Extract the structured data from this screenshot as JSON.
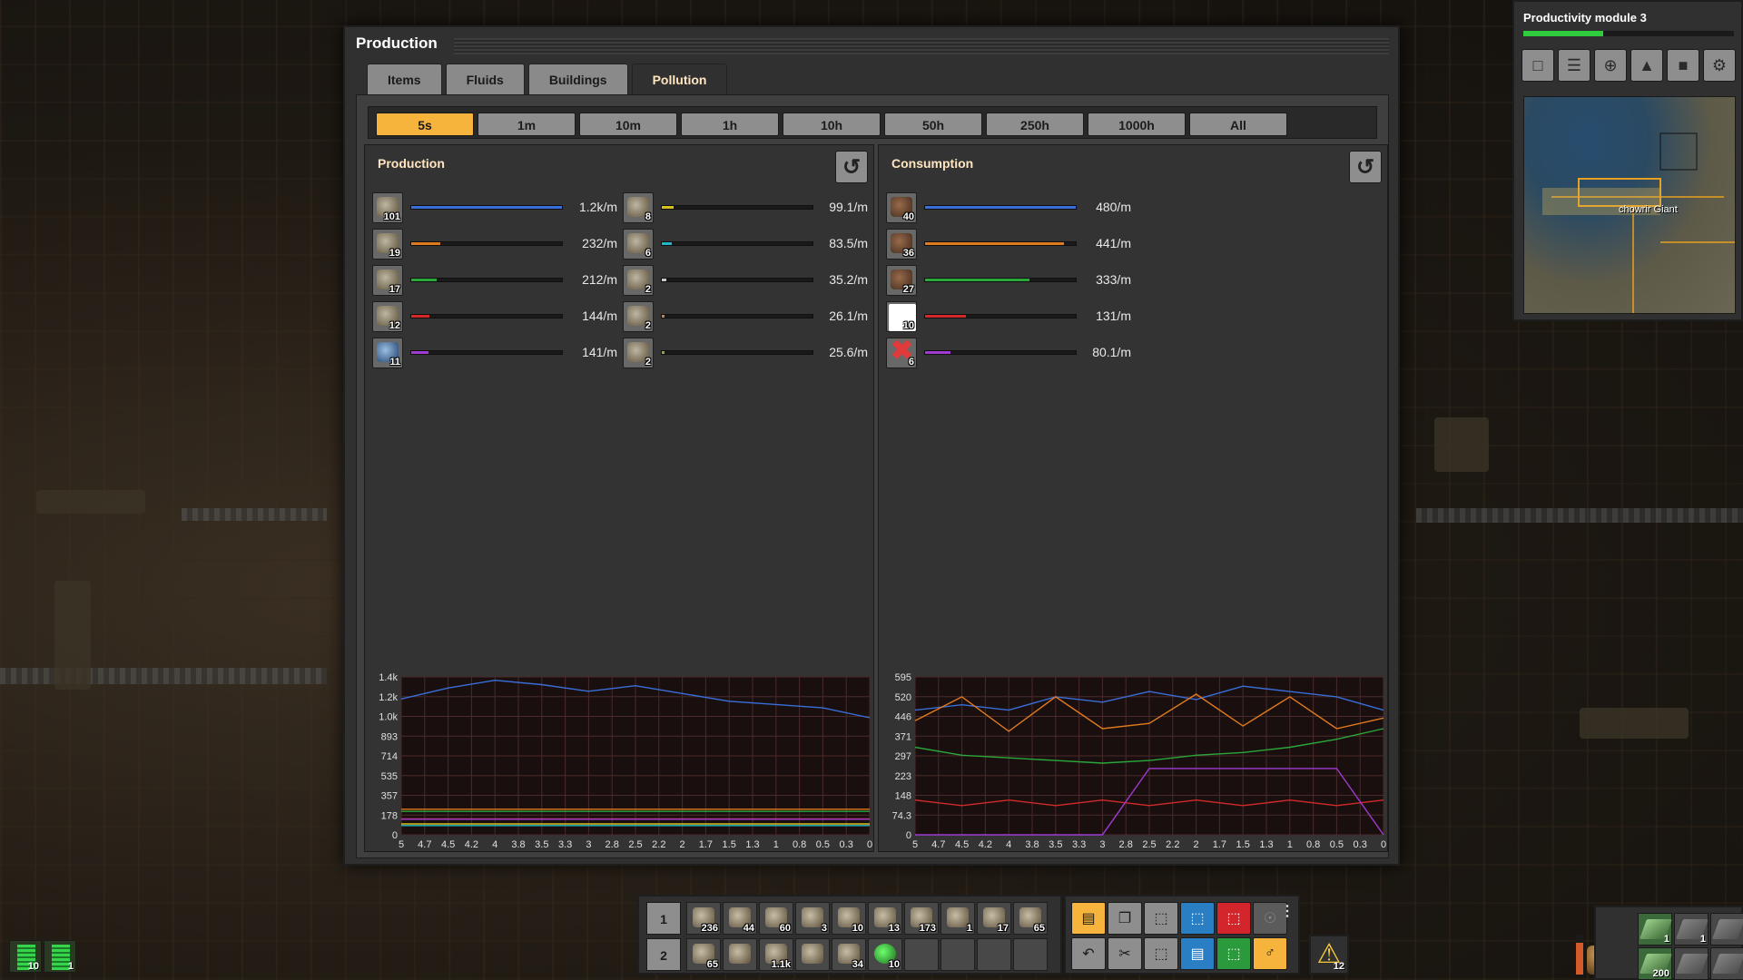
{
  "window": {
    "title": "Production",
    "tabs": [
      {
        "label": "Items",
        "active": false
      },
      {
        "label": "Fluids",
        "active": false
      },
      {
        "label": "Buildings",
        "active": false
      },
      {
        "label": "Pollution",
        "active": true
      }
    ],
    "time_ranges": [
      {
        "label": "5s",
        "active": true
      },
      {
        "label": "1m",
        "active": false
      },
      {
        "label": "10m",
        "active": false
      },
      {
        "label": "1h",
        "active": false
      },
      {
        "label": "10h",
        "active": false
      },
      {
        "label": "50h",
        "active": false
      },
      {
        "label": "250h",
        "active": false
      },
      {
        "label": "1000h",
        "active": false
      },
      {
        "label": "All",
        "active": false
      }
    ]
  },
  "production": {
    "title": "Production",
    "rows": [
      {
        "icon": "mining-drill-icon",
        "count": "101",
        "rate": "1.2k/m",
        "fraction": 1.0,
        "color": "#3a6ed8"
      },
      {
        "icon": "stone-furnace-icon",
        "count": "19",
        "rate": "232/m",
        "fraction": 0.19,
        "color": "#e07a1e"
      },
      {
        "icon": "pumpjack-icon",
        "count": "17",
        "rate": "212/m",
        "fraction": 0.17,
        "color": "#2aa83a"
      },
      {
        "icon": "steel-furnace-icon",
        "count": "12",
        "rate": "144/m",
        "fraction": 0.12,
        "color": "#d22a2a"
      },
      {
        "icon": "oil-refinery-icon",
        "count": "11",
        "rate": "141/m",
        "fraction": 0.115,
        "color": "#a03ad0"
      },
      {
        "icon": "boiler-icon",
        "count": "8",
        "rate": "99.1/m",
        "fraction": 0.08,
        "color": "#d8c020"
      },
      {
        "icon": "chemical-plant-icon",
        "count": "6",
        "rate": "83.5/m",
        "fraction": 0.068,
        "color": "#20b8c8"
      },
      {
        "icon": "assembling-machine-icon",
        "count": "2",
        "rate": "35.2/m",
        "fraction": 0.029,
        "color": "#c8c8c8"
      },
      {
        "icon": "assembling-machine-2-icon",
        "count": "2",
        "rate": "26.1/m",
        "fraction": 0.021,
        "color": "#d08050"
      },
      {
        "icon": "offshore-pump-icon",
        "count": "2",
        "rate": "25.6/m",
        "fraction": 0.021,
        "color": "#a0a040"
      }
    ],
    "chart": {
      "yticks": [
        "1.4k",
        "1.2k",
        "1.0k",
        "893",
        "714",
        "535",
        "357",
        "178",
        "0"
      ],
      "ymax": 1430,
      "xticks": [
        "5",
        "4.7",
        "4.5",
        "4.2",
        "4",
        "3.8",
        "3.5",
        "3.3",
        "3",
        "2.8",
        "2.5",
        "2.2",
        "2",
        "1.7",
        "1.5",
        "1.3",
        "1",
        "0.8",
        "0.5",
        "0.3",
        "0"
      ]
    }
  },
  "consumption": {
    "title": "Consumption",
    "rows": [
      {
        "icon": "tree-icon",
        "count": "40",
        "rate": "480/m",
        "fraction": 1.0,
        "color": "#3a6ed8"
      },
      {
        "icon": "dead-tree-icon",
        "count": "36",
        "rate": "441/m",
        "fraction": 0.92,
        "color": "#e07a1e"
      },
      {
        "icon": "dry-tree-icon",
        "count": "27",
        "rate": "333/m",
        "fraction": 0.69,
        "color": "#2aa83a"
      },
      {
        "icon": "blank-white-icon",
        "count": "10",
        "rate": "131/m",
        "fraction": 0.27,
        "color": "#d22a2a"
      },
      {
        "icon": "red-x-icon",
        "count": "6",
        "rate": "80.1/m",
        "fraction": 0.167,
        "color": "#a03ad0"
      }
    ],
    "chart": {
      "yticks": [
        "595",
        "520",
        "446",
        "371",
        "297",
        "223",
        "148",
        "74.3",
        "0"
      ],
      "ymax": 595,
      "xticks": [
        "5",
        "4.7",
        "4.5",
        "4.2",
        "4",
        "3.8",
        "3.5",
        "3.3",
        "3",
        "2.8",
        "2.5",
        "2.2",
        "2",
        "1.7",
        "1.5",
        "1.3",
        "1",
        "0.8",
        "0.5",
        "0.3",
        "0"
      ]
    }
  },
  "chart_data": [
    {
      "type": "line",
      "x": [
        5,
        4.5,
        4,
        3.5,
        3,
        2.5,
        2,
        1.5,
        1,
        0.5,
        0
      ],
      "series": [
        {
          "color": "#3a6ed8",
          "values": [
            1230,
            1330,
            1400,
            1360,
            1300,
            1350,
            1280,
            1210,
            1180,
            1150,
            1060
          ]
        },
        {
          "color": "#e07a1e",
          "values": [
            232,
            232,
            232,
            232,
            232,
            232,
            232,
            232,
            232,
            232,
            232
          ]
        },
        {
          "color": "#2aa83a",
          "values": [
            212,
            212,
            212,
            212,
            212,
            212,
            212,
            212,
            212,
            212,
            212
          ]
        },
        {
          "color": "#d22a2a",
          "values": [
            144,
            144,
            144,
            144,
            144,
            144,
            144,
            144,
            144,
            144,
            144
          ]
        },
        {
          "color": "#a03ad0",
          "values": [
            141,
            141,
            141,
            141,
            141,
            141,
            141,
            141,
            141,
            141,
            141
          ]
        },
        {
          "color": "#d8c020",
          "values": [
            99,
            99,
            99,
            99,
            99,
            99,
            99,
            99,
            99,
            99,
            99
          ]
        },
        {
          "color": "#20b8c8",
          "values": [
            84,
            84,
            84,
            84,
            84,
            84,
            84,
            84,
            84,
            84,
            84
          ]
        }
      ],
      "xlim": [
        5,
        0
      ],
      "ylim": [
        0,
        1430
      ],
      "grid": true
    },
    {
      "type": "line",
      "x": [
        5,
        4.5,
        4,
        3.5,
        3,
        2.5,
        2,
        1.5,
        1,
        0.5,
        0
      ],
      "series": [
        {
          "color": "#3a6ed8",
          "values": [
            470,
            490,
            470,
            520,
            500,
            540,
            510,
            560,
            540,
            520,
            470
          ]
        },
        {
          "color": "#e07a1e",
          "values": [
            430,
            520,
            390,
            520,
            400,
            420,
            530,
            410,
            520,
            400,
            440
          ]
        },
        {
          "color": "#2aa83a",
          "values": [
            330,
            300,
            290,
            280,
            270,
            280,
            300,
            310,
            330,
            360,
            400
          ]
        },
        {
          "color": "#d22a2a",
          "values": [
            131,
            110,
            131,
            110,
            131,
            110,
            131,
            110,
            131,
            110,
            131
          ]
        },
        {
          "color": "#a03ad0",
          "values": [
            0,
            0,
            0,
            0,
            0,
            250,
            250,
            250,
            250,
            250,
            0
          ]
        }
      ],
      "xlim": [
        5,
        0
      ],
      "ylim": [
        0,
        595
      ],
      "grid": true
    }
  ],
  "minimap": {
    "title": "Productivity module 3",
    "progress": 0.38,
    "buttons": [
      "blank-icon",
      "production-stats-icon",
      "add-marker-icon",
      "technology-icon",
      "train-icon",
      "settings-icon"
    ],
    "labels": [
      "chowrir",
      "Giant"
    ]
  },
  "quickbar": {
    "row1": {
      "num": "1",
      "slots": [
        {
          "icon": "solar-panel-icon",
          "count": "236"
        },
        {
          "icon": "inserter-icon",
          "count": "44"
        },
        {
          "icon": "medium-pole-icon",
          "count": "60"
        },
        {
          "icon": "rail-icon",
          "count": "3"
        },
        {
          "icon": "big-pole-icon",
          "count": "10"
        },
        {
          "icon": "construction-robot-icon",
          "count": "13"
        },
        {
          "icon": "belt-icon",
          "count": "173"
        },
        {
          "icon": "pipe-icon",
          "count": "1"
        },
        {
          "icon": "pole-icon",
          "count": "17"
        },
        {
          "icon": "fire-icon",
          "count": "65"
        }
      ]
    },
    "row2": {
      "num": "2",
      "slots": [
        {
          "icon": "flamethrower-ammo-icon",
          "count": "65"
        },
        {
          "icon": "landfill-icon",
          "count": ""
        },
        {
          "icon": "stone-wall-icon",
          "count": "1.1k"
        },
        {
          "icon": "gate-icon",
          "count": ""
        },
        {
          "icon": "turret-icon",
          "count": "34"
        },
        {
          "icon": "capsule-icon",
          "count": "10"
        },
        {
          "icon": "empty",
          "count": ""
        },
        {
          "icon": "empty",
          "count": ""
        },
        {
          "icon": "empty",
          "count": ""
        },
        {
          "icon": "empty",
          "count": ""
        }
      ]
    }
  },
  "shortcuts": [
    "alt-mode-icon",
    "copy-icon",
    "cut-tool-icon",
    "blueprint-select-icon",
    "deconstruct-icon",
    "robot-icon",
    "undo-icon",
    "scissors-icon",
    "upgrade-planner-icon",
    "blueprint-book-icon",
    "green-select-icon",
    "key-icon"
  ],
  "alerts": {
    "count": "12"
  },
  "batteries": [
    {
      "count": "10"
    },
    {
      "count": "1"
    }
  ],
  "weapons": [
    {
      "count": "1"
    },
    {
      "count": "1"
    },
    {
      "count": ""
    },
    {
      "count": "200"
    },
    {
      "count": ""
    },
    {
      "count": ""
    }
  ]
}
